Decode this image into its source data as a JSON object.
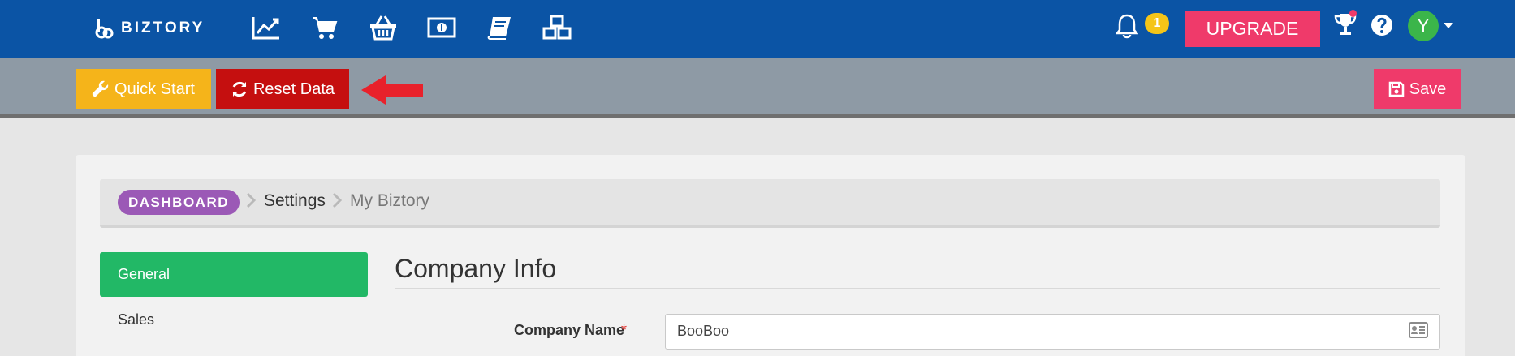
{
  "header": {
    "brand": "BIZTORY",
    "nav_icons": [
      "chart-line-icon",
      "cart-icon",
      "basket-icon",
      "money-icon",
      "book-icon",
      "cubes-icon"
    ],
    "notification_count": "1",
    "upgrade_label": "UPGRADE",
    "avatar_initial": "Y"
  },
  "toolbar": {
    "quick_start_label": "Quick Start",
    "reset_data_label": "Reset Data",
    "save_label": "Save"
  },
  "breadcrumb": {
    "root": "DASHBOARD",
    "items": [
      "Settings",
      "My Biztory"
    ]
  },
  "sidebar": {
    "items": [
      {
        "label": "General",
        "active": true
      },
      {
        "label": "Sales",
        "active": false
      }
    ]
  },
  "main": {
    "section_title": "Company Info",
    "fields": [
      {
        "label": "Company Name",
        "required_mark": "*",
        "value": "BooBoo"
      }
    ]
  },
  "colors": {
    "header_bg": "#0b54a5",
    "toolbar_bg": "#8e9aa5",
    "quick_start": "#f5b41a",
    "reset_data": "#c50f0f",
    "save": "#ef3a6a",
    "upgrade": "#ef3a6a",
    "dashboard_pill": "#9b59b6",
    "sidebar_active": "#22b866",
    "avatar": "#3bb54a",
    "badge": "#f5c518",
    "annotation_arrow": "#e8212b"
  }
}
